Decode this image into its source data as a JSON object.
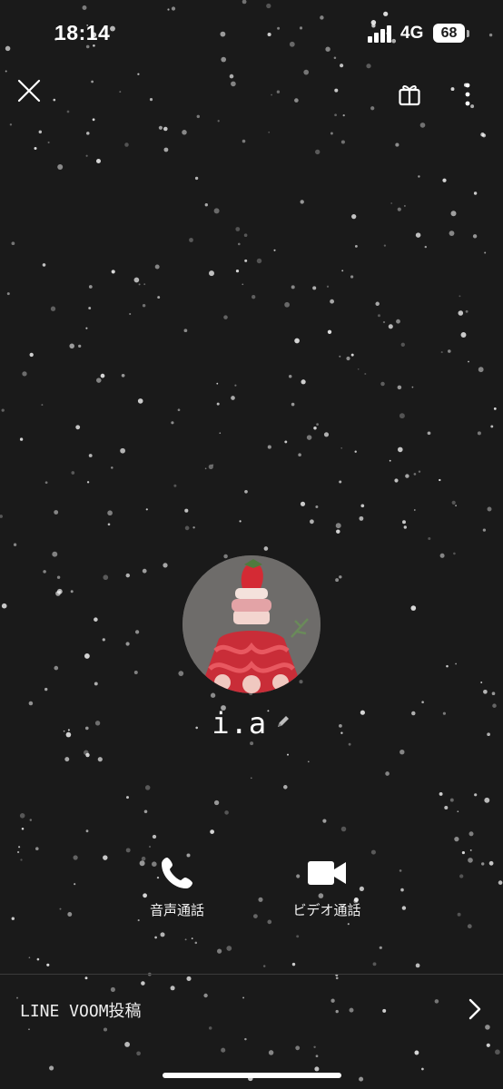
{
  "status_bar": {
    "time": "18:14",
    "network": "4G",
    "battery": "68"
  },
  "header": {
    "close_icon": "close-icon",
    "gift_icon": "gift-icon",
    "more_icon": "more-vertical-icon"
  },
  "profile": {
    "name": "i.a",
    "avatar_description": "strawberry-tower-cake",
    "edit_icon": "pencil-icon"
  },
  "actions": {
    "voice_call": {
      "label": "音声通話",
      "icon": "phone-icon"
    },
    "video_call": {
      "label": "ビデオ通話",
      "icon": "video-camera-icon"
    }
  },
  "voom": {
    "label": "LINE VOOM投稿",
    "icon": "chevron-right-icon"
  },
  "colors": {
    "background": "#1a1a1a",
    "text": "#ffffff",
    "divider": "#3b3b3b",
    "accent_strawberry": "#d8323c"
  }
}
